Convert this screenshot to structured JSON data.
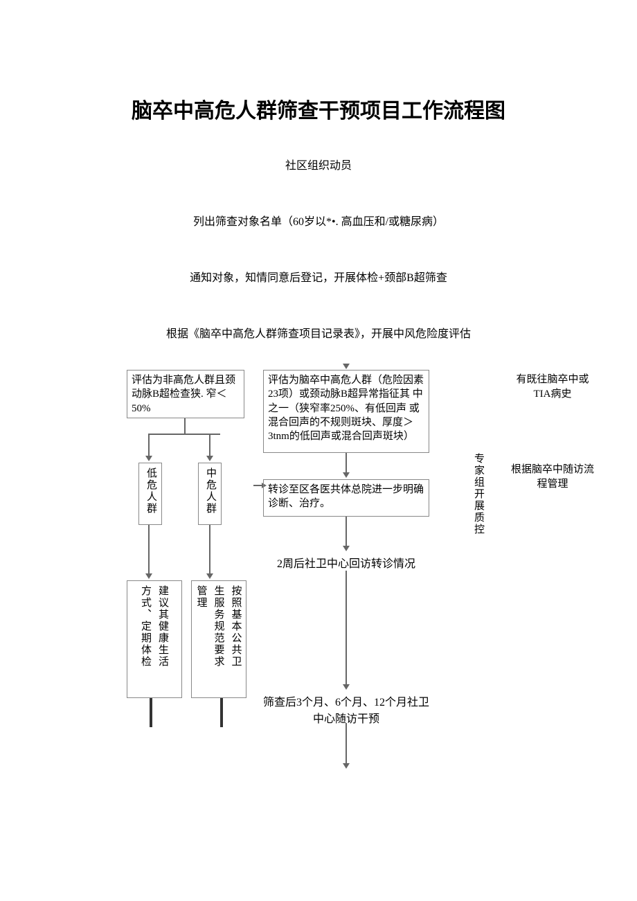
{
  "title": "脑卒中高危人群筛查干预项目工作流程图",
  "steps": {
    "s1": "社区组织动员",
    "s2": "列出筛查对象名单（60岁以*•. 高血压和/或糖尿病）",
    "s3": "通知对象，知情同意后登记，开展体检+颈部B超筛查",
    "s4": "根据《脑卒中高危人群筛查项目记录表》，开展中风危险度评估"
  },
  "branches": {
    "non_high_risk": "评估为非高危人群且颈动脉B超检查狭. 窄＜50%",
    "high_risk": "评估为脑卒中高危人群（危险因素23项）或颈动脉B超异常指征其 中之一（狭窄率250%、有低回声 或混合回声的不规则斑块、厚度＞3tnm的低回声或混合回声斑块）",
    "history": "有既往脑卒中或TIA病史",
    "history_followup": "根据脑卒中随访流程管理"
  },
  "risk_groups": {
    "low": "低危人群",
    "mid": "中危人群"
  },
  "advice": {
    "low_col1": "建议其健康生活",
    "low_col2": "方式、定期体检",
    "mid_col1": "按照基本公共卫",
    "mid_col2": "生服务规范要求",
    "mid_col3": "管理"
  },
  "referral": "转诊至区各医共体总院进一步明确诊断、治疗。",
  "followup_2w": "2周后社卫中心回访转诊情况",
  "followup_schedule": "筛查后3个月、6个月、12个月社卫中心随访干预",
  "qc_note": "专家组开展质控",
  "chart_data": {
    "type": "flowchart",
    "title": "脑卒中高危人群筛查干预项目工作流程图",
    "nodes": [
      {
        "id": "n1",
        "label": "社区组织动员"
      },
      {
        "id": "n2",
        "label": "列出筛查对象名单（60岁以上，高血压和/或糖尿病）"
      },
      {
        "id": "n3",
        "label": "通知对象，知情同意后登记，开展体检+颈部B超筛查"
      },
      {
        "id": "n4",
        "label": "根据《脑卒中高危人群筛查项目记录表》，开展中风危险度评估"
      },
      {
        "id": "b_left",
        "label": "评估为非高危人群且颈动脉B超检查狭窄＜50%"
      },
      {
        "id": "b_mid",
        "label": "评估为脑卒中高危人群（危险因素≥3项）或颈动脉B超异常指征其中之一（狭窄率≥50%、有低回声或混合回声的不规则斑块、厚度＞3mm的低回声或混合回声斑块）"
      },
      {
        "id": "b_right",
        "label": "有既往脑卒中或TIA病史"
      },
      {
        "id": "low",
        "label": "低危人群"
      },
      {
        "id": "midr",
        "label": "中危人群"
      },
      {
        "id": "low_adv",
        "label": "建议其健康生活方式、定期体检"
      },
      {
        "id": "mid_adv",
        "label": "按照基本公共卫生服务规范要求管理"
      },
      {
        "id": "ref",
        "label": "转诊至区各医共体总院进一步明确诊断、治疗。"
      },
      {
        "id": "fu2w",
        "label": "2周后社卫中心回访转诊情况"
      },
      {
        "id": "fu3",
        "label": "筛查后3个月、6个月、12个月社卫中心随访干预"
      },
      {
        "id": "hist_fu",
        "label": "根据脑卒中随访流程管理"
      },
      {
        "id": "qc",
        "label": "专家组开展质控"
      }
    ],
    "edges": [
      [
        "n1",
        "n2"
      ],
      [
        "n2",
        "n3"
      ],
      [
        "n3",
        "n4"
      ],
      [
        "n4",
        "b_left"
      ],
      [
        "n4",
        "b_mid"
      ],
      [
        "n4",
        "b_right"
      ],
      [
        "b_left",
        "low"
      ],
      [
        "b_left",
        "midr"
      ],
      [
        "low",
        "low_adv"
      ],
      [
        "midr",
        "mid_adv"
      ],
      [
        "b_mid",
        "ref"
      ],
      [
        "ref",
        "fu2w"
      ],
      [
        "fu2w",
        "fu3"
      ],
      [
        "b_right",
        "hist_fu"
      ]
    ]
  }
}
